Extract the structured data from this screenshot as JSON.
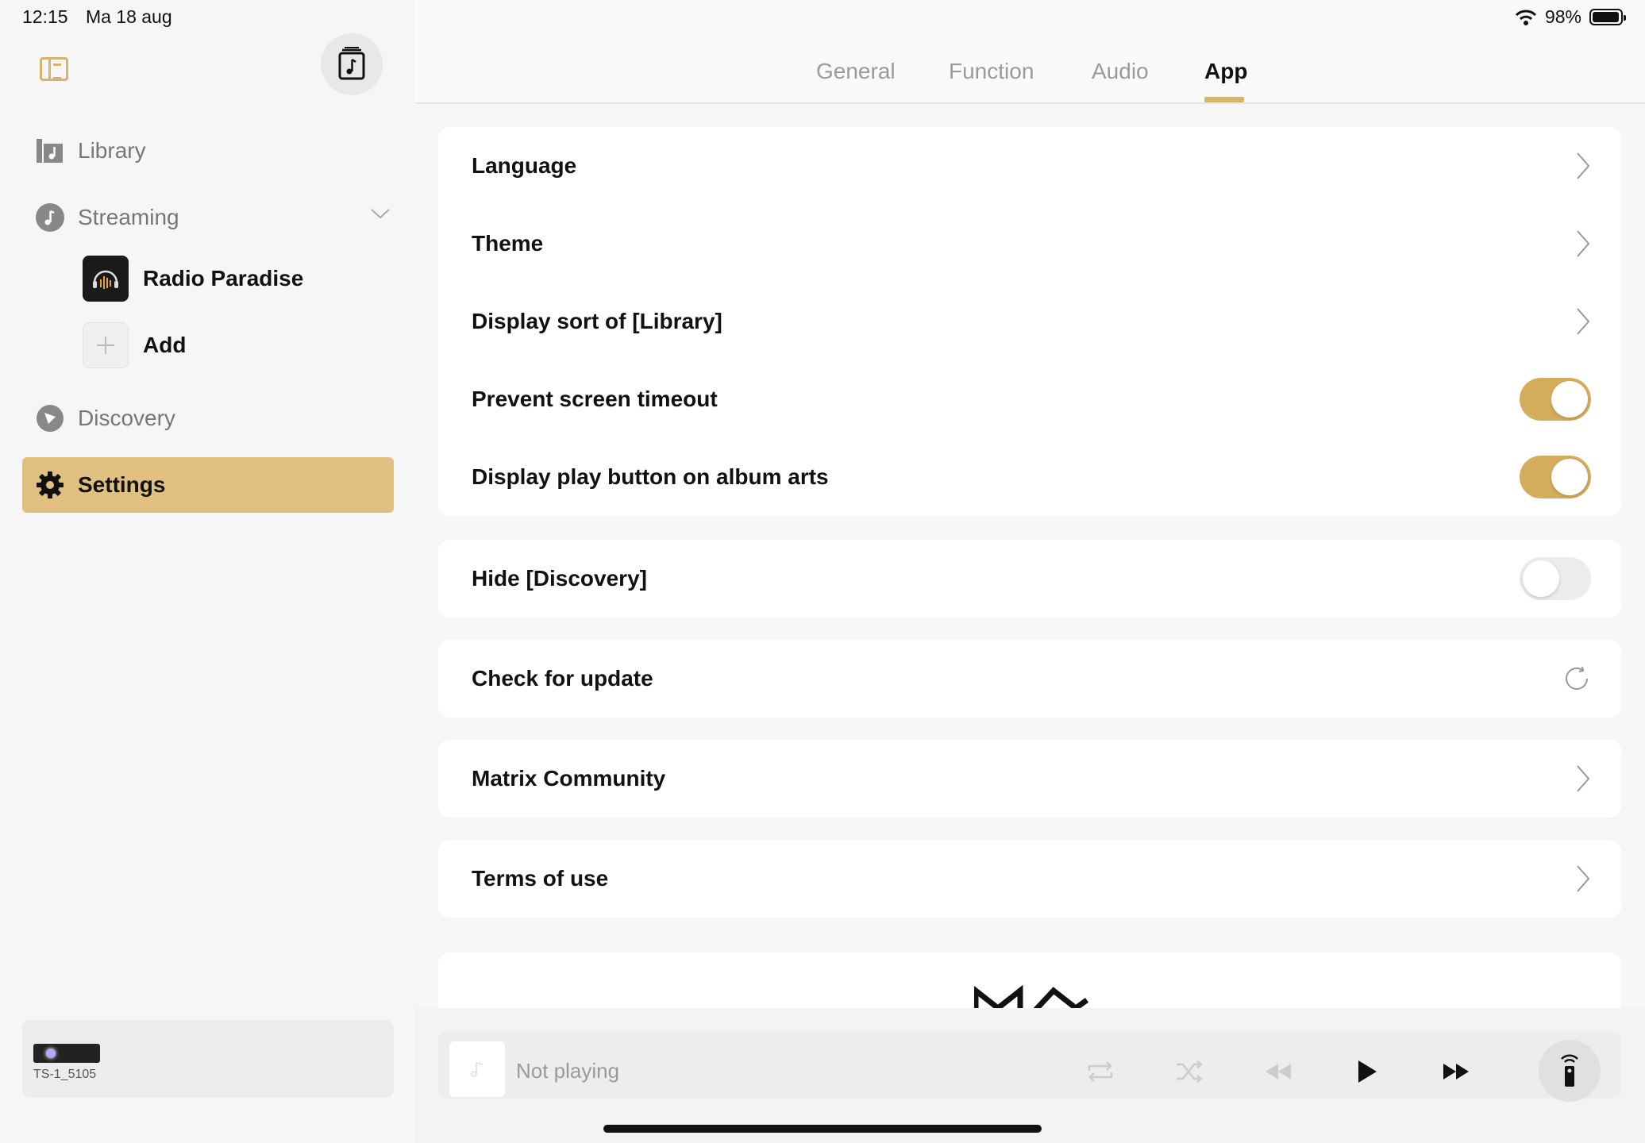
{
  "status": {
    "time": "12:15",
    "date": "Ma 18 aug",
    "battery": "98%"
  },
  "sidebar": {
    "items": [
      {
        "label": "Library"
      },
      {
        "label": "Streaming"
      },
      {
        "label": "Discovery"
      },
      {
        "label": "Settings"
      }
    ],
    "streaming_sub": [
      {
        "label": "Radio Paradise"
      },
      {
        "label": "Add"
      }
    ],
    "device": {
      "name": "TS-1_5105"
    }
  },
  "tabs": [
    "General",
    "Function",
    "Audio",
    "App"
  ],
  "active_tab": "App",
  "settings": {
    "language": "Language",
    "theme": "Theme",
    "display_sort": "Display sort of [Library]",
    "prevent_timeout": {
      "label": "Prevent screen timeout",
      "on": true
    },
    "display_play": {
      "label": "Display play button on album arts",
      "on": true
    },
    "hide_discovery": {
      "label": "Hide [Discovery]",
      "on": false
    },
    "check_update": "Check for update",
    "community": "Matrix Community",
    "terms": "Terms of use"
  },
  "player": {
    "status": "Not playing"
  },
  "colors": {
    "accent": "#d4ad5c",
    "active_nav": "#dfc081"
  }
}
